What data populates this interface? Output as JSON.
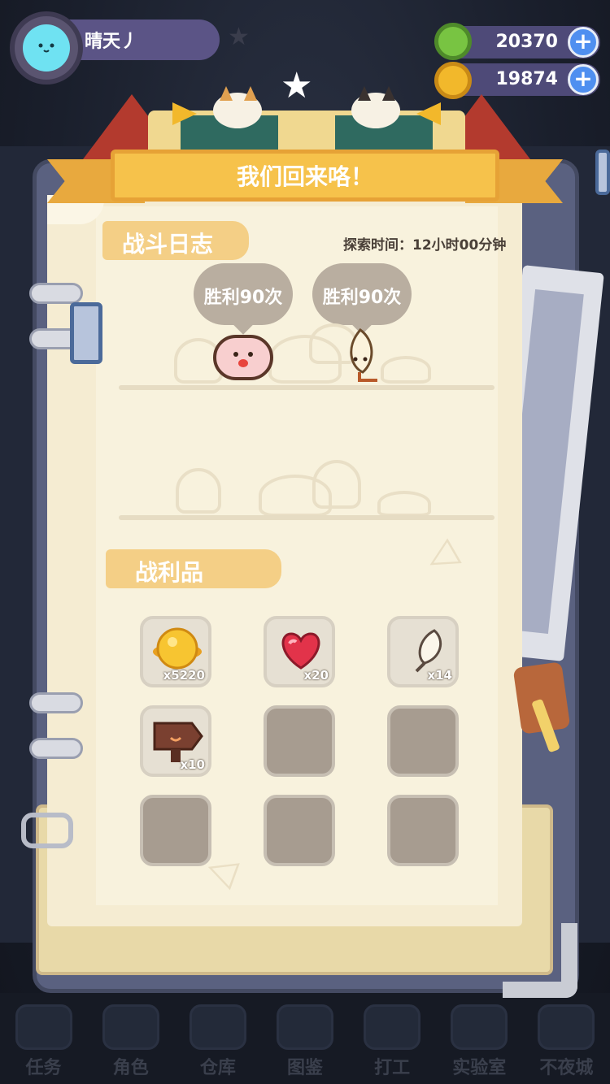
{
  "player": {
    "name": "晴天丿"
  },
  "currencies": [
    {
      "name": "green-token",
      "value": "20370",
      "color": "#78c442"
    },
    {
      "name": "gold-coin",
      "value": "19874",
      "color": "#f2b82b"
    }
  ],
  "dialog": {
    "title": "我们回来咯！",
    "battle_log": {
      "label": "战斗日志",
      "explore_time": "探索时间：12小时00分钟",
      "results": [
        {
          "text": "胜利90次"
        },
        {
          "text": "胜利90次"
        }
      ]
    },
    "loot": {
      "label": "战利品",
      "items": [
        {
          "icon": "gold-coin-icon",
          "count": "x5220"
        },
        {
          "icon": "heart-icon",
          "count": "x20"
        },
        {
          "icon": "feather-icon",
          "count": "x14"
        },
        {
          "icon": "wooden-sign-icon",
          "count": "x10"
        },
        {
          "icon": "",
          "count": ""
        },
        {
          "icon": "",
          "count": ""
        },
        {
          "icon": "",
          "count": ""
        },
        {
          "icon": "",
          "count": ""
        },
        {
          "icon": "",
          "count": ""
        }
      ]
    }
  },
  "bottom_nav": [
    {
      "label": "任务"
    },
    {
      "label": "角色"
    },
    {
      "label": "仓库"
    },
    {
      "label": "图鉴"
    },
    {
      "label": "打工"
    },
    {
      "label": "实验室"
    },
    {
      "label": "不夜城"
    }
  ],
  "colors": {
    "accent": "#f6c24b",
    "page": "#f8f2dd",
    "empty_slot": "#a79c90"
  }
}
